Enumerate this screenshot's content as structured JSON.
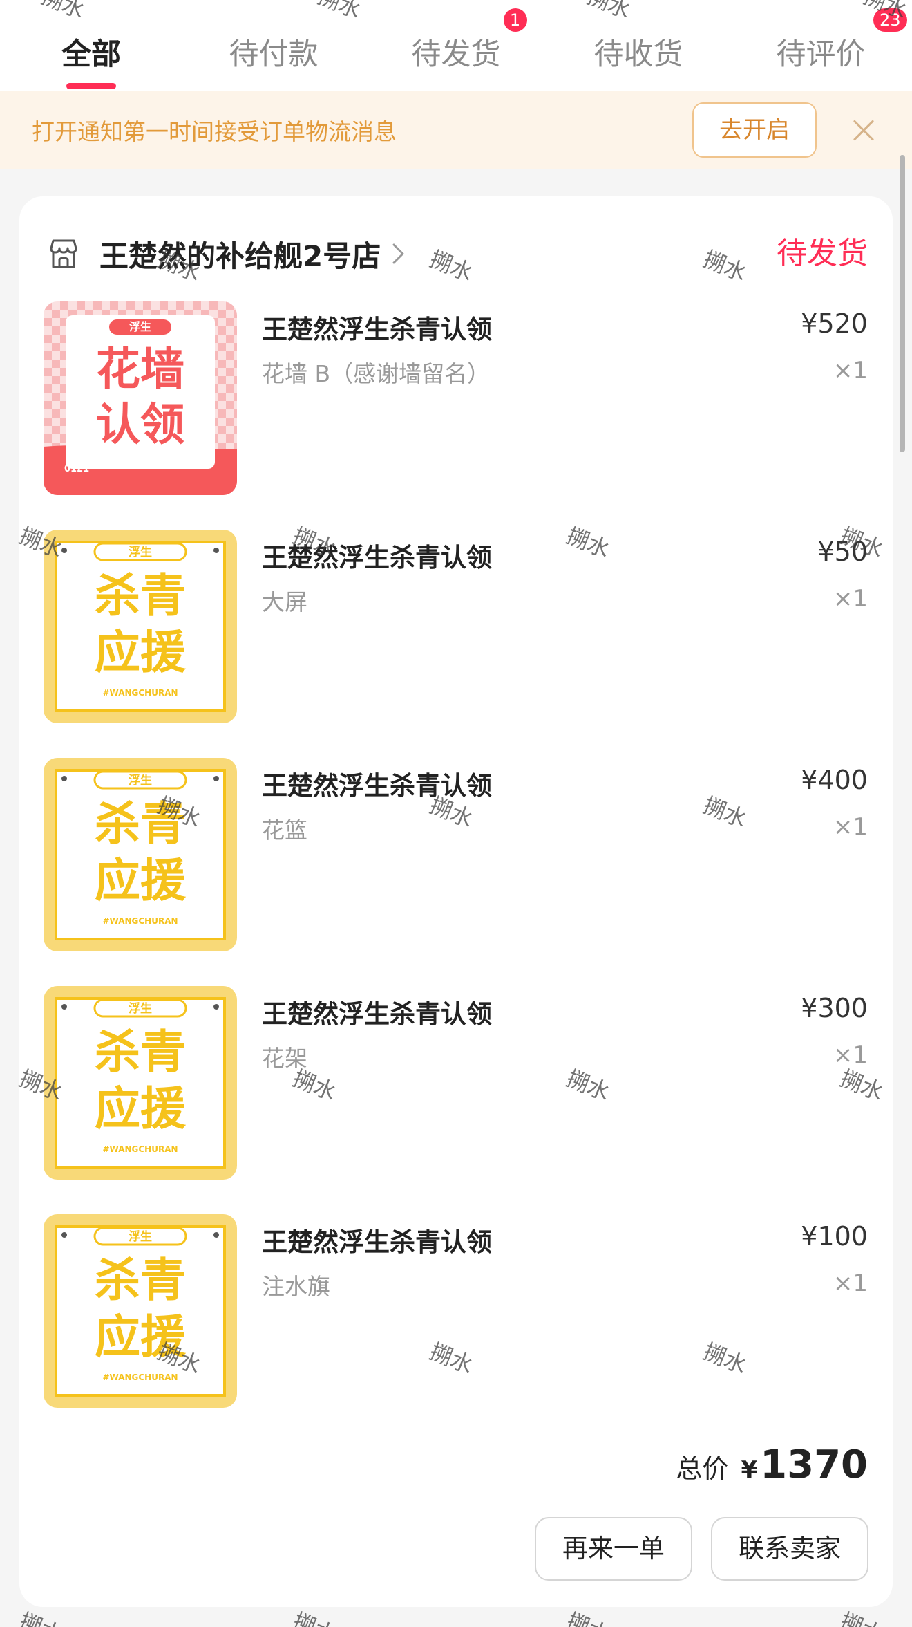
{
  "tabs": [
    {
      "label": "全部",
      "active": true,
      "badge": ""
    },
    {
      "label": "待付款",
      "active": false,
      "badge": ""
    },
    {
      "label": "待发货",
      "active": false,
      "badge": "1"
    },
    {
      "label": "待收货",
      "active": false,
      "badge": ""
    },
    {
      "label": "待评价",
      "active": false,
      "badge": "23"
    }
  ],
  "notice": {
    "text": "打开通知第一时间接受订单物流消息",
    "button": "去开启",
    "close_icon": "close-icon"
  },
  "order": {
    "store_name": "王楚然的补给舰2号店",
    "status": "待发货",
    "items": [
      {
        "title": "王楚然浮生杀青认领",
        "spec": "花墙 B（感谢墙留名）",
        "price": "¥520",
        "qty": "×1",
        "thumb_line1": "花墙",
        "thumb_line2": "认领",
        "thumb_tag": "浮生",
        "thumb_code": "0121"
      },
      {
        "title": "王楚然浮生杀青认领",
        "spec": "大屏",
        "price": "¥50",
        "qty": "×1",
        "thumb_line1": "杀青",
        "thumb_line2": "应援",
        "thumb_tag": "浮生",
        "thumb_code": "#WANGCHURAN"
      },
      {
        "title": "王楚然浮生杀青认领",
        "spec": "花篮",
        "price": "¥400",
        "qty": "×1",
        "thumb_line1": "杀青",
        "thumb_line2": "应援",
        "thumb_tag": "浮生",
        "thumb_code": "#WANGCHURAN"
      },
      {
        "title": "王楚然浮生杀青认领",
        "spec": "花架",
        "price": "¥300",
        "qty": "×1",
        "thumb_line1": "杀青",
        "thumb_line2": "应援",
        "thumb_tag": "浮生",
        "thumb_code": "#WANGCHURAN"
      },
      {
        "title": "王楚然浮生杀青认领",
        "spec": "注水旗",
        "price": "¥100",
        "qty": "×1",
        "thumb_line1": "杀青",
        "thumb_line2": "应援",
        "thumb_tag": "浮生",
        "thumb_code": "#WANGCHURAN"
      }
    ],
    "total_label": "总价",
    "total_currency": "¥",
    "total_value": "1370",
    "buttons": {
      "again": "再来一单",
      "contact": "联系卖家"
    }
  },
  "watermark": "搠水",
  "colors": {
    "accent": "#ff2d55",
    "notice_bg": "#fdf4e9",
    "notice_text": "#e29a3a",
    "thumb_red": "#f5585a",
    "thumb_yellow": "#f5c21b"
  }
}
